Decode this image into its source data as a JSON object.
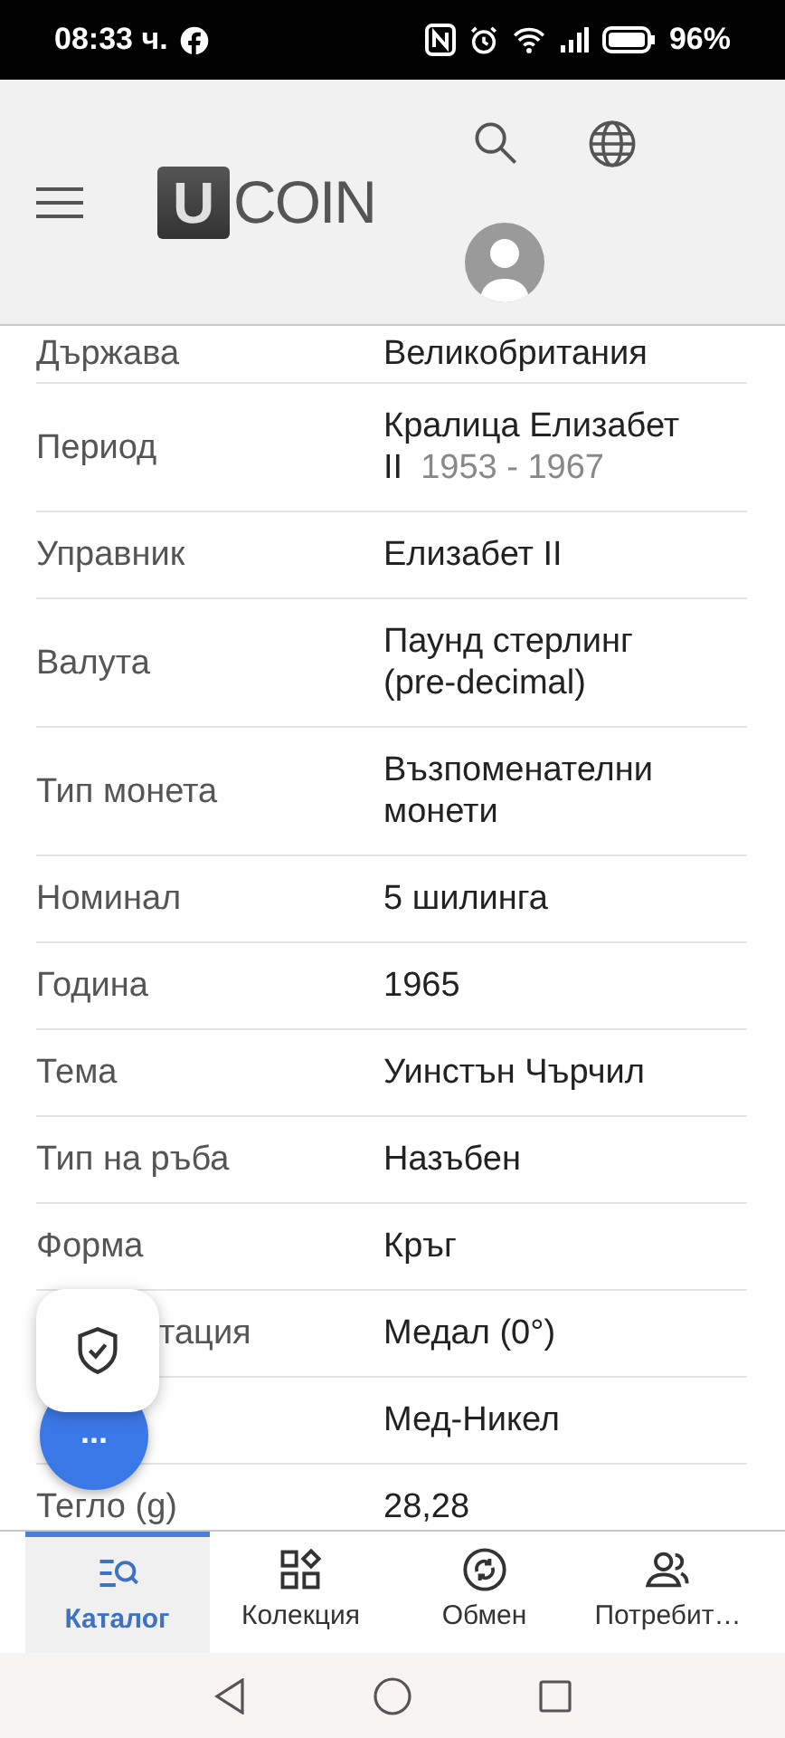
{
  "status_bar": {
    "time": "08:33 ч.",
    "battery": "96%"
  },
  "header": {
    "logo_letter": "U",
    "logo_text": "COIN"
  },
  "rows": [
    {
      "label": "Държава",
      "value": "Великобритания"
    },
    {
      "label": "Период",
      "value": "Кралица Елизабет II",
      "note": "1953 - 1967"
    },
    {
      "label": "Управник",
      "value": "Елизабет II"
    },
    {
      "label": "Валута",
      "value": "Паунд стерлинг (pre-decimal)"
    },
    {
      "label": "Тип монета",
      "value": "Възпоменателни монети"
    },
    {
      "label": "Номинал",
      "value": "5 шилинга"
    },
    {
      "label": "Година",
      "value": "1965"
    },
    {
      "label": "Тема",
      "value": "Уинстън Чърчил"
    },
    {
      "label": "Тип на ръба",
      "value": "Назъбен"
    },
    {
      "label": "Форма",
      "value": "Кръг"
    },
    {
      "label": "тация",
      "value": "Медал (0°)"
    },
    {
      "value": "Мед-Никел"
    },
    {
      "label": "Тегло (g)",
      "value": "28,28"
    }
  ],
  "fab": {
    "label": "..."
  },
  "bottom_nav": [
    {
      "label": "Каталог",
      "kind": "catalog",
      "selected": true
    },
    {
      "label": "Колекция",
      "kind": "collection",
      "selected": false
    },
    {
      "label": "Обмен",
      "kind": "exchange",
      "selected": false
    },
    {
      "label": "Потребит…",
      "kind": "users",
      "selected": false
    }
  ]
}
